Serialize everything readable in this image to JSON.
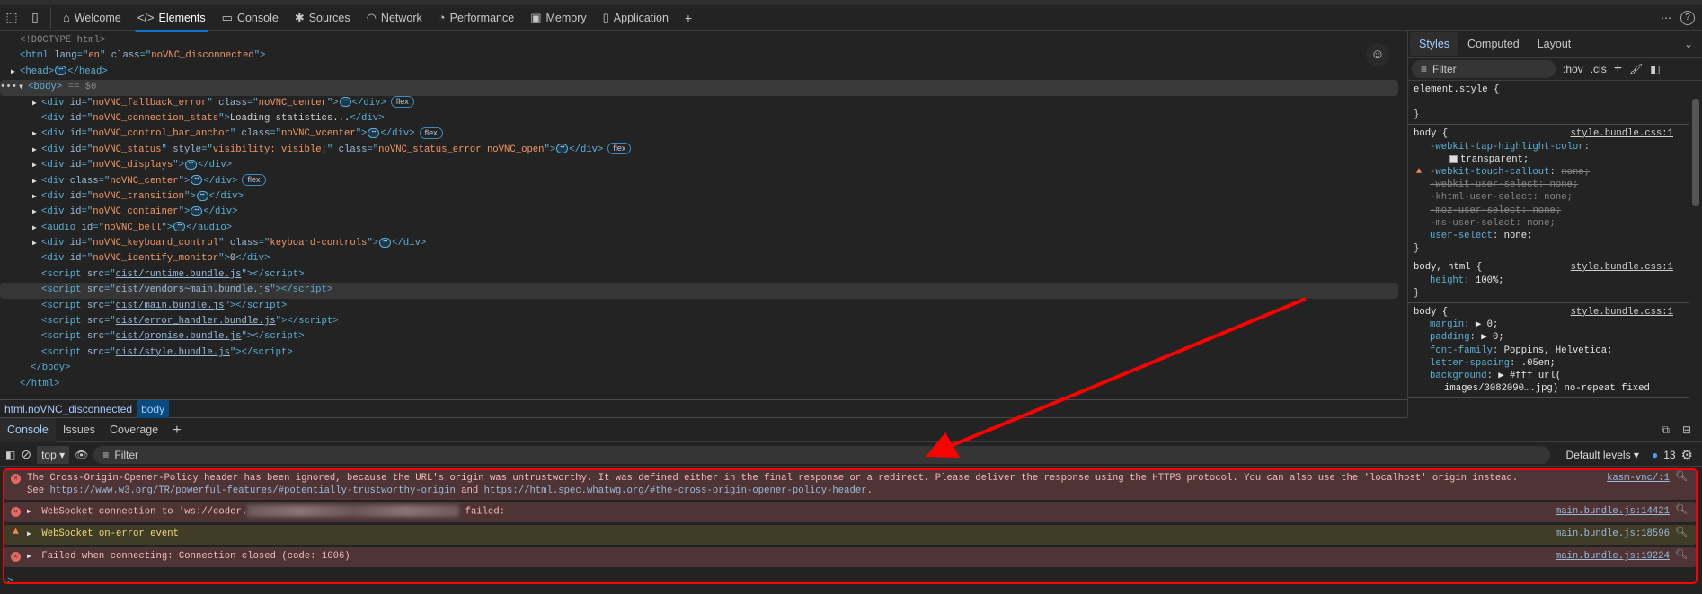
{
  "toolbar": {
    "tabs": [
      {
        "label": "Welcome",
        "icon": "home-icon"
      },
      {
        "label": "Elements",
        "icon": "code-icon",
        "active": true
      },
      {
        "label": "Console",
        "icon": "console-icon"
      },
      {
        "label": "Sources",
        "icon": "bug-icon"
      },
      {
        "label": "Network",
        "icon": "wifi-icon"
      },
      {
        "label": "Performance",
        "icon": "gauge-icon"
      },
      {
        "label": "Memory",
        "icon": "chip-icon"
      },
      {
        "label": "Application",
        "icon": "cylinder-icon"
      }
    ],
    "add_tab": "+",
    "more": "⋯",
    "help": "?"
  },
  "elements": {
    "rows": [
      {
        "i": 0,
        "tri": "",
        "t": [
          [
            "cm",
            "<!DOCTYPE html>"
          ]
        ]
      },
      {
        "i": 0,
        "tri": "",
        "t": [
          [
            "tag",
            "<html "
          ],
          [
            "an",
            "lang"
          ],
          [
            "tag",
            "=\""
          ],
          [
            "av",
            "en"
          ],
          [
            "tag",
            "\" "
          ],
          [
            "an",
            "class"
          ],
          [
            "tag",
            "=\""
          ],
          [
            "av",
            "noVNC_disconnected"
          ],
          [
            "tag",
            "\">"
          ]
        ]
      },
      {
        "i": 0,
        "tri": "▶",
        "t": [
          [
            "tag",
            "<head>"
          ],
          [
            "ell",
            ""
          ],
          [
            "tag",
            "</head>"
          ]
        ]
      },
      {
        "i": 0,
        "tri": "▼",
        "sel": true,
        "pre": "•••",
        "t": [
          [
            "tag",
            "<body>"
          ],
          [
            "cm",
            " == $0"
          ]
        ]
      },
      {
        "i": 1,
        "tri": "▶",
        "t": [
          [
            "tag",
            "<div "
          ],
          [
            "an",
            "id"
          ],
          [
            "tag",
            "=\""
          ],
          [
            "av",
            "noVNC_fallback_error"
          ],
          [
            "tag",
            "\" "
          ],
          [
            "an",
            "class"
          ],
          [
            "tag",
            "=\""
          ],
          [
            "av",
            "noVNC_center"
          ],
          [
            "tag",
            "\">"
          ],
          [
            "ell",
            ""
          ],
          [
            "tag",
            "</div>"
          ],
          [
            "flex",
            "flex"
          ]
        ]
      },
      {
        "i": 1,
        "tri": "",
        "t": [
          [
            "tag",
            "<div "
          ],
          [
            "an",
            "id"
          ],
          [
            "tag",
            "=\""
          ],
          [
            "av",
            "noVNC_connection_stats"
          ],
          [
            "tag",
            "\">"
          ],
          [
            "tx",
            "Loading statistics..."
          ],
          [
            "tag",
            "</div>"
          ]
        ]
      },
      {
        "i": 1,
        "tri": "▶",
        "t": [
          [
            "tag",
            "<div "
          ],
          [
            "an",
            "id"
          ],
          [
            "tag",
            "=\""
          ],
          [
            "av",
            "noVNC_control_bar_anchor"
          ],
          [
            "tag",
            "\" "
          ],
          [
            "an",
            "class"
          ],
          [
            "tag",
            "=\""
          ],
          [
            "av",
            "noVNC_vcenter"
          ],
          [
            "tag",
            "\">"
          ],
          [
            "ell",
            ""
          ],
          [
            "tag",
            "</div>"
          ],
          [
            "flex",
            "flex"
          ]
        ]
      },
      {
        "i": 1,
        "tri": "▶",
        "t": [
          [
            "tag",
            "<div "
          ],
          [
            "an",
            "id"
          ],
          [
            "tag",
            "=\""
          ],
          [
            "av",
            "noVNC_status"
          ],
          [
            "tag",
            "\" "
          ],
          [
            "an",
            "style"
          ],
          [
            "tag",
            "=\""
          ],
          [
            "av",
            "visibility: visible;"
          ],
          [
            "tag",
            "\" "
          ],
          [
            "an",
            "class"
          ],
          [
            "tag",
            "=\""
          ],
          [
            "av",
            "noVNC_status_error noVNC_open"
          ],
          [
            "tag",
            "\">"
          ],
          [
            "ell",
            ""
          ],
          [
            "tag",
            "</div>"
          ],
          [
            "flex",
            "flex"
          ]
        ]
      },
      {
        "i": 1,
        "tri": "▶",
        "t": [
          [
            "tag",
            "<div "
          ],
          [
            "an",
            "id"
          ],
          [
            "tag",
            "=\""
          ],
          [
            "av",
            "noVNC_displays"
          ],
          [
            "tag",
            "\">"
          ],
          [
            "ell",
            ""
          ],
          [
            "tag",
            "</div>"
          ]
        ]
      },
      {
        "i": 1,
        "tri": "▶",
        "t": [
          [
            "tag",
            "<div "
          ],
          [
            "an",
            "class"
          ],
          [
            "tag",
            "=\""
          ],
          [
            "av",
            "noVNC_center"
          ],
          [
            "tag",
            "\">"
          ],
          [
            "ell",
            ""
          ],
          [
            "tag",
            "</div>"
          ],
          [
            "flex",
            "flex"
          ]
        ]
      },
      {
        "i": 1,
        "tri": "▶",
        "t": [
          [
            "tag",
            "<div "
          ],
          [
            "an",
            "id"
          ],
          [
            "tag",
            "=\""
          ],
          [
            "av",
            "noVNC_transition"
          ],
          [
            "tag",
            "\">"
          ],
          [
            "ell",
            ""
          ],
          [
            "tag",
            "</div>"
          ]
        ]
      },
      {
        "i": 1,
        "tri": "▶",
        "t": [
          [
            "tag",
            "<div "
          ],
          [
            "an",
            "id"
          ],
          [
            "tag",
            "=\""
          ],
          [
            "av",
            "noVNC_container"
          ],
          [
            "tag",
            "\">"
          ],
          [
            "ell",
            ""
          ],
          [
            "tag",
            "</div>"
          ]
        ]
      },
      {
        "i": 1,
        "tri": "▶",
        "t": [
          [
            "tag",
            "<audio "
          ],
          [
            "an",
            "id"
          ],
          [
            "tag",
            "=\""
          ],
          [
            "av",
            "noVNC_bell"
          ],
          [
            "tag",
            "\">"
          ],
          [
            "ell",
            ""
          ],
          [
            "tag",
            "</audio>"
          ]
        ]
      },
      {
        "i": 1,
        "tri": "▶",
        "t": [
          [
            "tag",
            "<div "
          ],
          [
            "an",
            "id"
          ],
          [
            "tag",
            "=\""
          ],
          [
            "av",
            "noVNC_keyboard_control"
          ],
          [
            "tag",
            "\" "
          ],
          [
            "an",
            "class"
          ],
          [
            "tag",
            "=\""
          ],
          [
            "av",
            "keyboard-controls"
          ],
          [
            "tag",
            "\">"
          ],
          [
            "ell",
            ""
          ],
          [
            "tag",
            "</div>"
          ]
        ]
      },
      {
        "i": 1,
        "tri": "",
        "t": [
          [
            "tag",
            "<div "
          ],
          [
            "an",
            "id"
          ],
          [
            "tag",
            "=\""
          ],
          [
            "av",
            "noVNC_identify_monitor"
          ],
          [
            "tag",
            "\">"
          ],
          [
            "tx",
            "0"
          ],
          [
            "tag",
            "</div>"
          ]
        ]
      },
      {
        "i": 1,
        "tri": "",
        "t": [
          [
            "tag",
            "<script "
          ],
          [
            "an",
            "src"
          ],
          [
            "tag",
            "=\""
          ],
          [
            "link",
            "dist/runtime.bundle.js"
          ],
          [
            "tag",
            "\"></script>"
          ]
        ]
      },
      {
        "i": 1,
        "tri": "",
        "hov": true,
        "t": [
          [
            "tag",
            "<script "
          ],
          [
            "an",
            "src"
          ],
          [
            "tag",
            "=\""
          ],
          [
            "link",
            "dist/vendors~main.bundle.js"
          ],
          [
            "tag",
            "\"></script>"
          ]
        ]
      },
      {
        "i": 1,
        "tri": "",
        "t": [
          [
            "tag",
            "<script "
          ],
          [
            "an",
            "src"
          ],
          [
            "tag",
            "=\""
          ],
          [
            "link",
            "dist/main.bundle.js"
          ],
          [
            "tag",
            "\"></script>"
          ]
        ]
      },
      {
        "i": 1,
        "tri": "",
        "t": [
          [
            "tag",
            "<script "
          ],
          [
            "an",
            "src"
          ],
          [
            "tag",
            "=\""
          ],
          [
            "link",
            "dist/error_handler.bundle.js"
          ],
          [
            "tag",
            "\"></script>"
          ]
        ]
      },
      {
        "i": 1,
        "tri": "",
        "t": [
          [
            "tag",
            "<script "
          ],
          [
            "an",
            "src"
          ],
          [
            "tag",
            "=\""
          ],
          [
            "link",
            "dist/promise.bundle.js"
          ],
          [
            "tag",
            "\"></script>"
          ]
        ]
      },
      {
        "i": 1,
        "tri": "",
        "t": [
          [
            "tag",
            "<script "
          ],
          [
            "an",
            "src"
          ],
          [
            "tag",
            "=\""
          ],
          [
            "link",
            "dist/style.bundle.js"
          ],
          [
            "tag",
            "\"></script>"
          ]
        ]
      },
      {
        "i": 0.5,
        "tri": "",
        "t": [
          [
            "tag",
            "</body>"
          ]
        ]
      },
      {
        "i": 0,
        "tri": "",
        "t": [
          [
            "tag",
            "</html>"
          ]
        ]
      }
    ]
  },
  "breadcrumb": {
    "items": [
      "html.noVNC_disconnected",
      "body"
    ]
  },
  "styles": {
    "tabs": [
      "Styles",
      "Computed",
      "Layout"
    ],
    "filter_placeholder": "Filter",
    "hov": ":hov",
    "cls": ".cls",
    "rules": [
      {
        "selector": "element.style {",
        "src": "",
        "props": [],
        "close": "}"
      },
      {
        "selector": "body {",
        "src": "style.bundle.css:1",
        "props": [
          {
            "n": "-webkit-tap-highlight-color",
            "v": "",
            "k": ""
          },
          {
            "n": "",
            "v": "transparent;",
            "k": "swatch-indent"
          },
          {
            "n": "-webkit-touch-callout",
            "v": "none;",
            "k": "warn"
          },
          {
            "n": "-webkit-user-select",
            "v": "none;",
            "k": "struck"
          },
          {
            "n": "-khtml-user-select",
            "v": "none;",
            "k": "disabled"
          },
          {
            "n": "-moz-user-select",
            "v": "none;",
            "k": "disabled"
          },
          {
            "n": "-ms-user-select",
            "v": "none;",
            "k": "disabled"
          },
          {
            "n": "user-select",
            "v": "none;",
            "k": ""
          }
        ],
        "close": "}"
      },
      {
        "selector": "body, html {",
        "src": "style.bundle.css:1",
        "props": [
          {
            "n": "height",
            "v": "100%;",
            "k": ""
          }
        ],
        "close": "}"
      },
      {
        "selector": "body {",
        "src": "style.bundle.css:1",
        "props": [
          {
            "n": "margin",
            "v": "▶ 0;",
            "k": ""
          },
          {
            "n": "padding",
            "v": "▶ 0;",
            "k": ""
          },
          {
            "n": "font-family",
            "v": "Poppins, Helvetica;",
            "k": ""
          },
          {
            "n": "letter-spacing",
            "v": ".05em;",
            "k": ""
          },
          {
            "n": "background",
            "v": "▶ #fff url(",
            "k": "bg"
          },
          {
            "n": "",
            "v": "images/3082090….jpg) no-repeat fixed",
            "k": "url-cont"
          }
        ],
        "close": ""
      }
    ]
  },
  "console": {
    "tabs": [
      "Console",
      "Issues",
      "Coverage"
    ],
    "context": "top ▾",
    "filter_placeholder": "Filter",
    "levels": "Default levels ▾",
    "issue_count": "13",
    "messages": [
      {
        "level": "error",
        "text": "The Cross-Origin-Opener-Policy header has been ignored, because the URL's origin was untrustworthy. It was defined either in the final response or a redirect. Please deliver the response using the HTTPS protocol. You can also use the 'localhost' origin instead.",
        "see": "See",
        "link1": "https://www.w3.org/TR/powerful-features/#potentially-trustworthy-origin",
        "and": "and",
        "link2": "https://html.spec.whatwg.org/#the-cross-origin-opener-policy-header",
        "src": "kasm-vnc/:1"
      },
      {
        "level": "error",
        "text": "WebSocket connection to 'ws://coder.",
        "text2": "failed:",
        "src": "main.bundle.js:14421"
      },
      {
        "level": "warning",
        "text": "WebSocket on-error event",
        "src": "main.bundle.js:18596"
      },
      {
        "level": "error",
        "text": "Failed when connecting: Connection closed (code: 1006)",
        "src": "main.bundle.js:19224"
      }
    ],
    "prompt": ">"
  },
  "colors": {
    "accent": "#0e74cf",
    "error_bg": "#4e3434",
    "warning_bg": "#413c26",
    "annotation": "#ff0000"
  }
}
